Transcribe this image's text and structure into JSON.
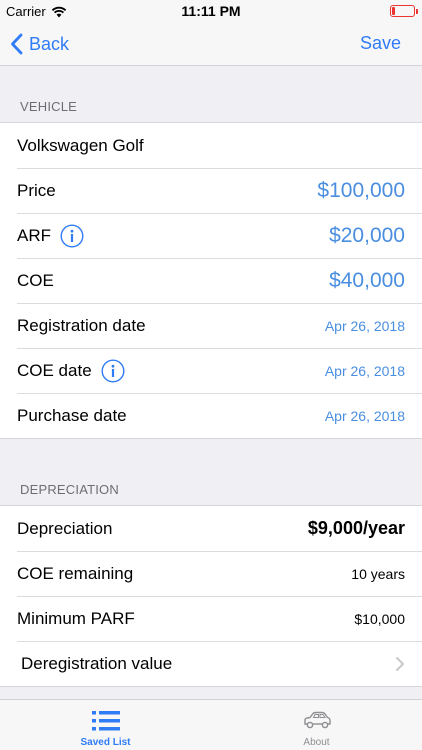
{
  "status_bar": {
    "carrier": "Carrier",
    "time": "11:11 PM"
  },
  "nav": {
    "back_label": "Back",
    "save_label": "Save"
  },
  "vehicle_section": {
    "header": "VEHICLE",
    "name": "Volkswagen Golf",
    "rows": [
      {
        "label": "Price",
        "value": "$100,000"
      },
      {
        "label": "ARF",
        "value": "$20,000"
      },
      {
        "label": "COE",
        "value": "$40,000"
      },
      {
        "label": "Registration date",
        "value": "Apr 26, 2018"
      },
      {
        "label": "COE date",
        "value": "Apr 26, 2018"
      },
      {
        "label": "Purchase date",
        "value": "Apr 26, 2018"
      }
    ]
  },
  "depreciation_section": {
    "header": "DEPRECIATION",
    "rows": [
      {
        "label": "Depreciation",
        "value": "$9,000/year"
      },
      {
        "label": "COE remaining",
        "value": "10 years"
      },
      {
        "label": "Minimum PARF",
        "value": "$10,000"
      },
      {
        "label": "Deregistration value"
      }
    ]
  },
  "tabs": [
    {
      "label": "Saved List",
      "icon": "list-icon",
      "active": true
    },
    {
      "label": "About",
      "icon": "car-icon",
      "active": false
    }
  ],
  "colors": {
    "accent": "#2f7cf6",
    "value_blue": "#4a8ee0",
    "battery": "#e33333"
  },
  "icons": {
    "wifi": "wifi-icon",
    "battery": "battery-icon",
    "back": "chevron-left-icon",
    "info": "info-icon",
    "disclosure": "chevron-right-icon"
  }
}
